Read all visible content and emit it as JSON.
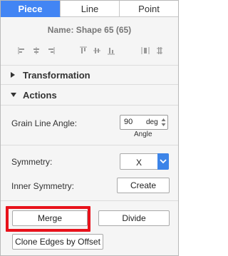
{
  "tabs": [
    {
      "label": "Piece",
      "active": true
    },
    {
      "label": "Line",
      "active": false
    },
    {
      "label": "Point",
      "active": false
    }
  ],
  "shape_name": "Name: Shape 65 (65)",
  "align_icons": [
    "align-left-icon",
    "align-center-vertical-icon",
    "align-right-icon",
    "align-top-icon",
    "align-middle-horizontal-icon",
    "align-bottom-icon",
    "distribute-horizontal-icon",
    "distribute-vertical-icon"
  ],
  "sections": {
    "transformation": "Transformation",
    "actions": "Actions"
  },
  "grain_line": {
    "label": "Grain Line Angle:",
    "value": "90",
    "unit": "deg",
    "sub_label": "Angle"
  },
  "symmetry": {
    "label": "Symmetry:",
    "selected": "X"
  },
  "inner_symmetry": {
    "label": "Inner Symmetry:",
    "button": "Create"
  },
  "buttons": {
    "merge": "Merge",
    "divide": "Divide",
    "clone": "Clone Edges by Offset"
  },
  "colors": {
    "accent": "#4285f4",
    "highlight": "#e8121b"
  }
}
